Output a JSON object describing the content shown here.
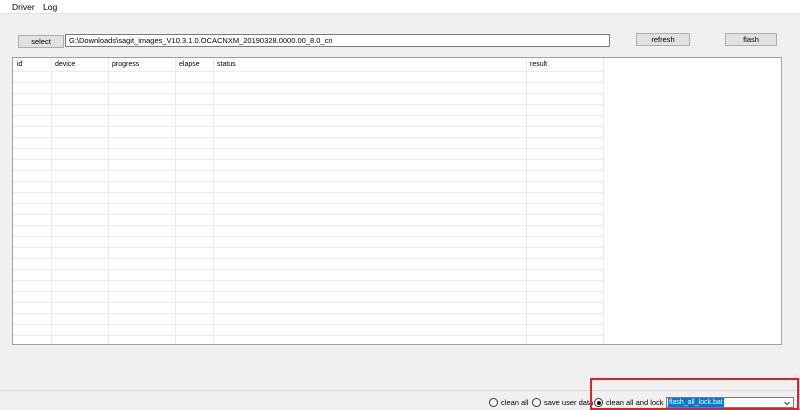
{
  "menu": {
    "items": [
      "Driver",
      "Log"
    ]
  },
  "toolbar": {
    "select_label": "select",
    "path_value": "G:\\Downloads\\sagit_images_V10.3.1.0.OCACNXM_20190328.0000.00_8.0_cn",
    "refresh_label": "refresh",
    "flash_label": "flash"
  },
  "grid": {
    "columns": [
      "id",
      "device",
      "progress",
      "elapse",
      "status",
      "result"
    ]
  },
  "options": {
    "clean_all": "clean all",
    "save_user_data": "save user data",
    "clean_all_and_lock": "clean all and lock",
    "selected": "clean_all_and_lock",
    "script_value": "flash_all_lock.bat"
  },
  "colors": {
    "highlight": "#e0202a",
    "selection": "#0078d7"
  }
}
